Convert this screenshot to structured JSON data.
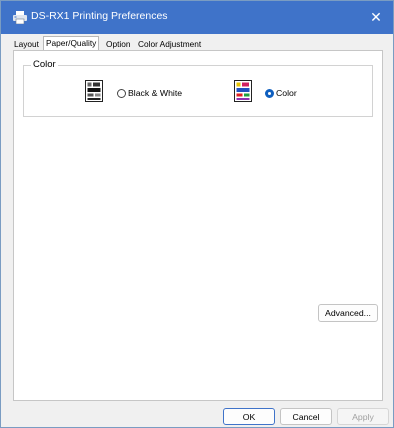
{
  "window": {
    "title": "DS-RX1 Printing Preferences",
    "title_icon": "printer-icon",
    "close_glyph": "✕"
  },
  "tabs": [
    {
      "label": "Layout",
      "active": false
    },
    {
      "label": "Paper/Quality",
      "active": true
    },
    {
      "label": "Option",
      "active": false
    },
    {
      "label": "Color Adjustment",
      "active": false
    }
  ],
  "color_group": {
    "label": "Color",
    "options": [
      {
        "label": "Black & White",
        "selected": false,
        "icon": "black-white-print-icon"
      },
      {
        "label": "Color",
        "selected": true,
        "icon": "color-print-icon"
      }
    ]
  },
  "advanced_button": {
    "label": "Advanced..."
  },
  "footer": {
    "ok_label": "OK",
    "cancel_label": "Cancel",
    "apply_label": "Apply",
    "apply_enabled": false
  },
  "colors": {
    "titlebar": "#3f73c9",
    "radio_selected": "#0f5fbf"
  }
}
